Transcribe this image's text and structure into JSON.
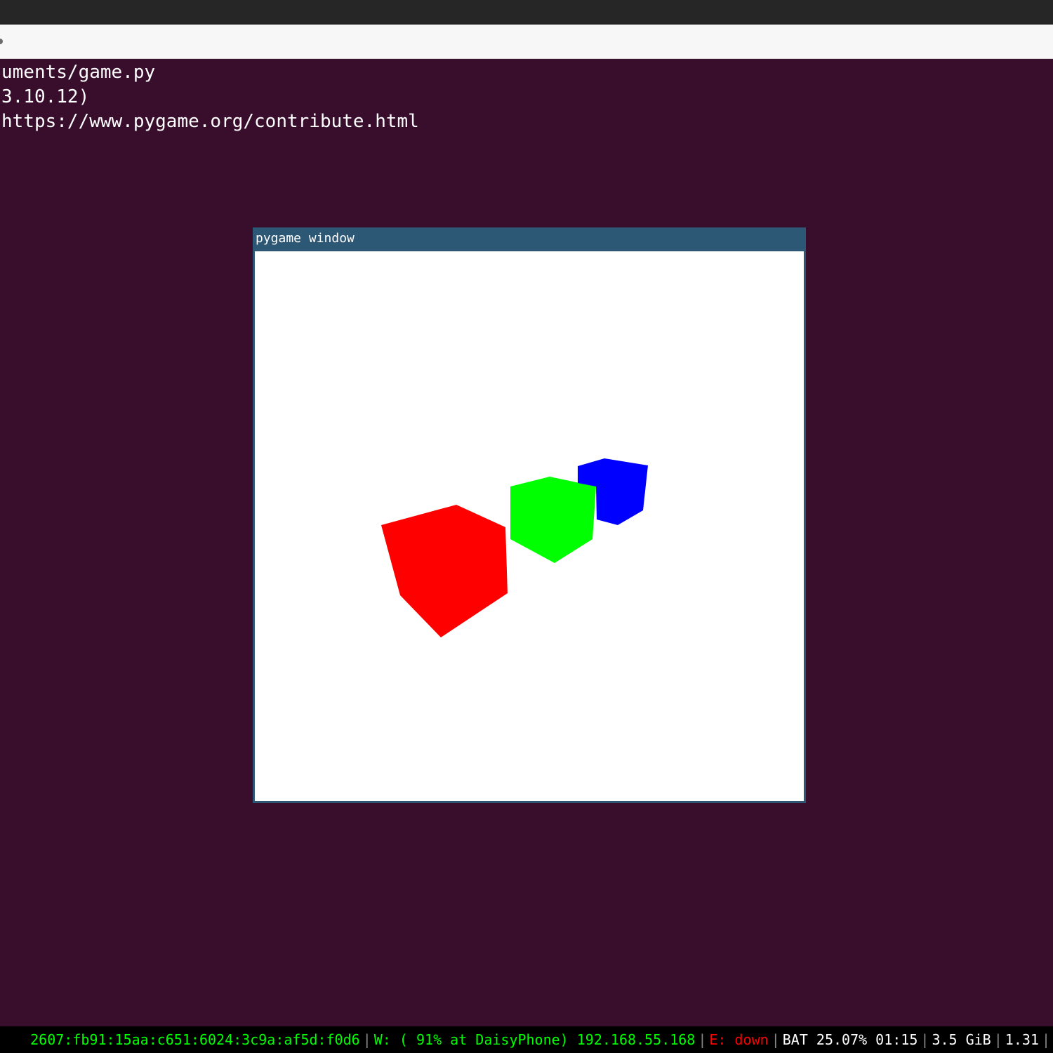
{
  "terminal": {
    "lines": [
      "uments/game.py",
      "3.10.12)",
      "https://www.pygame.org/contribute.html"
    ]
  },
  "pygame_window": {
    "title": "pygame window",
    "background_color": "#ffffff",
    "cubes": [
      {
        "name": "red-cube",
        "color": "#ff0000"
      },
      {
        "name": "green-cube",
        "color": "#00ff00"
      },
      {
        "name": "blue-cube",
        "color": "#0000ff"
      }
    ]
  },
  "status_bar": {
    "ipv6": "2607:fb91:15aa:c651:6024:3c9a:af5d:f0d6",
    "wireless": "W: ( 91% at DaisyPhone) 192.168.55.168",
    "ethernet": "E: down",
    "battery": "BAT 25.07% 01:15",
    "memory": "3.5 GiB",
    "load": "1.31",
    "separator": "|"
  },
  "colors": {
    "terminal_bg": "#380e2c",
    "titlebar": "#2c5876",
    "status_ok": "#00ff00",
    "status_bad": "#ff0000"
  }
}
